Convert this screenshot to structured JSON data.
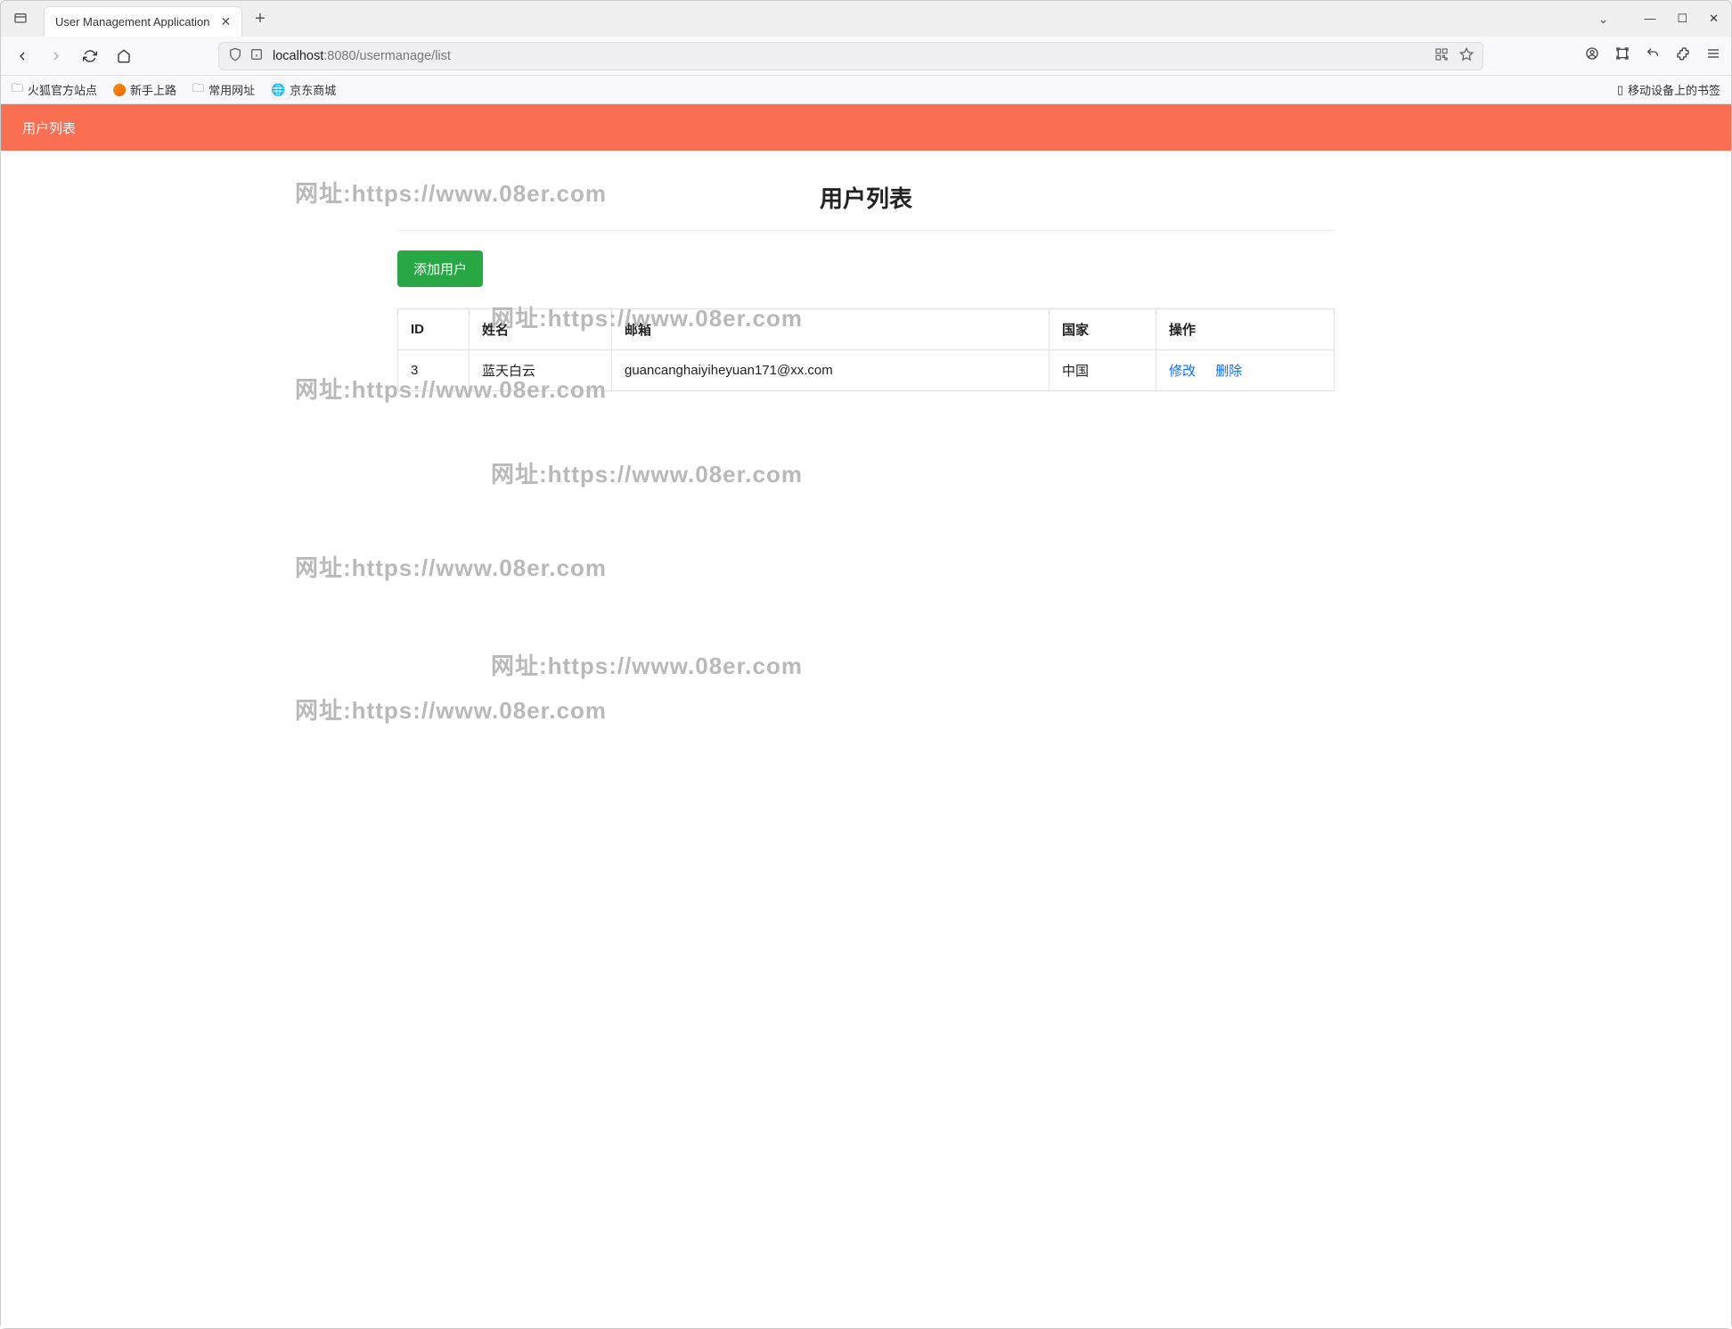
{
  "browser": {
    "tab_title": "User Management Application",
    "url_host": "localhost",
    "url_port": ":8080",
    "url_path": "/usermanage/list",
    "bookmarks": [
      {
        "label": "火狐官方站点",
        "icon": "folder"
      },
      {
        "label": "新手上路",
        "icon": "firefox"
      },
      {
        "label": "常用网址",
        "icon": "folder"
      },
      {
        "label": "京东商城",
        "icon": "globe"
      }
    ],
    "bookmarks_right": {
      "label": "移动设备上的书签",
      "icon": "device"
    }
  },
  "navbar": {
    "brand": "用户列表"
  },
  "page": {
    "title": "用户列表",
    "add_button": "添加用户"
  },
  "table": {
    "headers": [
      "ID",
      "姓名",
      "邮箱",
      "国家",
      "操作"
    ],
    "rows": [
      {
        "id": "3",
        "name": "蓝天白云",
        "email": "guancanghaiyiheyuan171@xx.com",
        "country": "中国"
      }
    ],
    "actions": {
      "edit": "修改",
      "delete": "删除"
    }
  },
  "watermark_text": "网址:https://www.08er.com"
}
